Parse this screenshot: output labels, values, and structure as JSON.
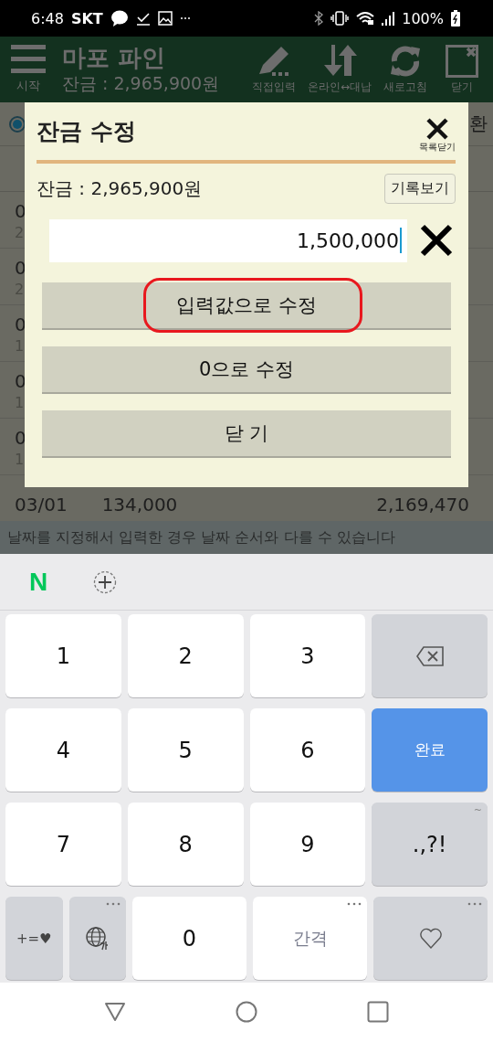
{
  "status_bar": {
    "time": "6:48",
    "carrier": "SKT",
    "battery": "100%"
  },
  "app_header": {
    "menu_label": "시작",
    "title": "마포 파인",
    "balance": "잔금 : 2,965,900원",
    "actions": [
      {
        "label": "직접입력"
      },
      {
        "label": "온라인↔대납"
      },
      {
        "label": "새로고침"
      },
      {
        "label": "닫기"
      }
    ]
  },
  "background": {
    "radio": {
      "selected": true
    },
    "right_fragment": "환",
    "rows": [
      {
        "line_1": "0",
        "line_2": "2"
      },
      {
        "line_1": "0",
        "line_2": "2"
      },
      {
        "line_1": "0",
        "line_2": "1"
      },
      {
        "line_1": "0",
        "line_2": "1"
      },
      {
        "line_1": "0",
        "line_2": "1"
      }
    ],
    "last_row": {
      "date": "03/01",
      "amount": "134,000",
      "balance": "2,169,470"
    },
    "notice": "날짜를 지정해서 입력한 경우 날짜 순서와 다를 수 있습니다"
  },
  "dialog": {
    "title": "잔금 수정",
    "close_label": "목록닫기",
    "balance": "잔금 : 2,965,900원",
    "history_button": "기록보기",
    "amount_value": "1,500,000",
    "buttons": [
      {
        "label": "입력값으로 수정",
        "highlighted": true
      },
      {
        "label": "0으로 수정",
        "highlighted": false
      },
      {
        "label": "닫 기",
        "highlighted": false
      }
    ]
  },
  "keyboard": {
    "logo": "N",
    "rows": [
      [
        {
          "kind": "char",
          "label": "1"
        },
        {
          "kind": "char",
          "label": "2"
        },
        {
          "kind": "char",
          "label": "3"
        },
        {
          "kind": "backspace"
        }
      ],
      [
        {
          "kind": "char",
          "label": "4"
        },
        {
          "kind": "char",
          "label": "5"
        },
        {
          "kind": "char",
          "label": "6"
        },
        {
          "kind": "done",
          "label": "완료"
        }
      ],
      [
        {
          "kind": "char",
          "label": "7"
        },
        {
          "kind": "char",
          "label": "8"
        },
        {
          "kind": "char",
          "label": "9"
        },
        {
          "kind": "punct",
          "label": ".,?!",
          "hint": "~"
        }
      ]
    ],
    "bottom_row": [
      {
        "kind": "symbol",
        "label": "+=♥"
      },
      {
        "kind": "globe",
        "more": true
      },
      {
        "kind": "char",
        "label": "0"
      },
      {
        "kind": "space",
        "label": "간격",
        "more": true
      },
      {
        "kind": "heart",
        "more": true
      }
    ]
  }
}
